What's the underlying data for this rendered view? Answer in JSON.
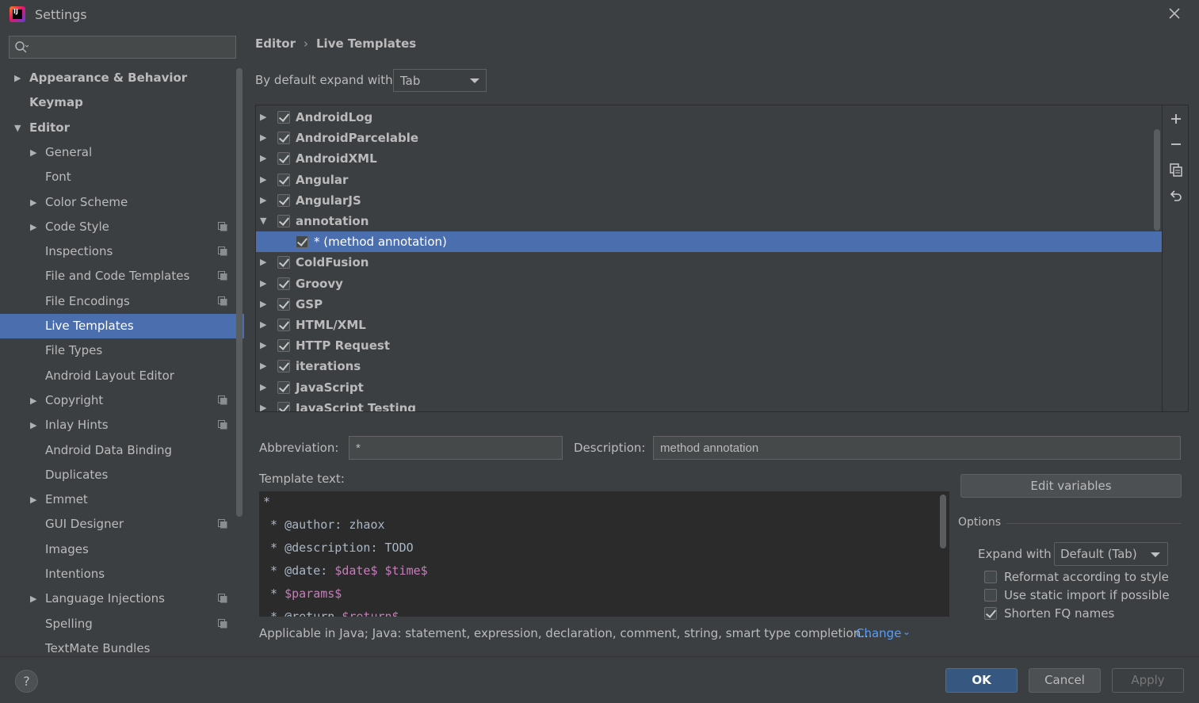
{
  "window": {
    "title": "Settings"
  },
  "sidebar": {
    "search": {
      "placeholder": "",
      "value": ""
    },
    "items": [
      {
        "label": "Appearance & Behavior",
        "bold": true,
        "arrow": "▶",
        "indent": 0
      },
      {
        "label": "Keymap",
        "bold": true,
        "arrow": "",
        "indent": 0
      },
      {
        "label": "Editor",
        "bold": true,
        "arrow": "▼",
        "indent": 0
      },
      {
        "label": "General",
        "arrow": "▶",
        "indent": 1
      },
      {
        "label": "Font",
        "arrow": "",
        "indent": 1
      },
      {
        "label": "Color Scheme",
        "arrow": "▶",
        "indent": 1
      },
      {
        "label": "Code Style",
        "arrow": "▶",
        "indent": 1,
        "project_icon": true
      },
      {
        "label": "Inspections",
        "arrow": "",
        "indent": 1,
        "project_icon": true
      },
      {
        "label": "File and Code Templates",
        "arrow": "",
        "indent": 1,
        "project_icon": true
      },
      {
        "label": "File Encodings",
        "arrow": "",
        "indent": 1,
        "project_icon": true
      },
      {
        "label": "Live Templates",
        "arrow": "",
        "indent": 1,
        "selected": true
      },
      {
        "label": "File Types",
        "arrow": "",
        "indent": 1
      },
      {
        "label": "Android Layout Editor",
        "arrow": "",
        "indent": 1
      },
      {
        "label": "Copyright",
        "arrow": "▶",
        "indent": 1,
        "project_icon": true
      },
      {
        "label": "Inlay Hints",
        "arrow": "▶",
        "indent": 1,
        "project_icon": true
      },
      {
        "label": "Android Data Binding",
        "arrow": "",
        "indent": 1
      },
      {
        "label": "Duplicates",
        "arrow": "",
        "indent": 1
      },
      {
        "label": "Emmet",
        "arrow": "▶",
        "indent": 1
      },
      {
        "label": "GUI Designer",
        "arrow": "",
        "indent": 1,
        "project_icon": true
      },
      {
        "label": "Images",
        "arrow": "",
        "indent": 1
      },
      {
        "label": "Intentions",
        "arrow": "",
        "indent": 1
      },
      {
        "label": "Language Injections",
        "arrow": "▶",
        "indent": 1,
        "project_icon": true
      },
      {
        "label": "Spelling",
        "arrow": "",
        "indent": 1,
        "project_icon": true
      },
      {
        "label": "TextMate Bundles",
        "arrow": "",
        "indent": 1
      }
    ]
  },
  "breadcrumb": {
    "parent": "Editor",
    "separator": "›",
    "current": "Live Templates"
  },
  "expand_default": {
    "label": "By default expand with",
    "value": "Tab"
  },
  "template_groups": [
    {
      "name": "AndroidLog",
      "checked": true,
      "arrow": "▶"
    },
    {
      "name": "AndroidParcelable",
      "checked": true,
      "arrow": "▶"
    },
    {
      "name": "AndroidXML",
      "checked": true,
      "arrow": "▶"
    },
    {
      "name": "Angular",
      "checked": true,
      "arrow": "▶"
    },
    {
      "name": "AngularJS",
      "checked": true,
      "arrow": "▶"
    },
    {
      "name": "annotation",
      "checked": true,
      "arrow": "▼"
    },
    {
      "name": "* (method annotation)",
      "checked": true,
      "arrow": "",
      "child": true,
      "selected": true
    },
    {
      "name": "ColdFusion",
      "checked": true,
      "arrow": "▶"
    },
    {
      "name": "Groovy",
      "checked": true,
      "arrow": "▶"
    },
    {
      "name": "GSP",
      "checked": true,
      "arrow": "▶"
    },
    {
      "name": "HTML/XML",
      "checked": true,
      "arrow": "▶"
    },
    {
      "name": "HTTP Request",
      "checked": true,
      "arrow": "▶"
    },
    {
      "name": "iterations",
      "checked": true,
      "arrow": "▶"
    },
    {
      "name": "JavaScript",
      "checked": true,
      "arrow": "▶"
    },
    {
      "name": "JavaScript Testing",
      "checked": true,
      "arrow": "▶"
    }
  ],
  "list_toolbar": {
    "add": "+",
    "remove": "−"
  },
  "details": {
    "abbreviation_label": "Abbreviation:",
    "abbreviation_value": "*",
    "description_label": "Description:",
    "description_value": "method annotation",
    "template_text_label": "Template text:",
    "template_lines": [
      [
        {
          "t": "*"
        }
      ],
      [
        {
          "t": " * @author: zhaox"
        }
      ],
      [
        {
          "t": " * @description: TODO"
        }
      ],
      [
        {
          "t": " * @date: "
        },
        {
          "t": "$date$",
          "v": true
        },
        {
          "t": " "
        },
        {
          "t": "$time$",
          "v": true
        }
      ],
      [
        {
          "t": " * "
        },
        {
          "t": "$params$",
          "v": true
        }
      ],
      [
        {
          "t": " * @return "
        },
        {
          "t": "$return$",
          "v": true
        }
      ]
    ],
    "applicable_text": "Applicable in Java; Java: statement, expression, declaration, comment, string, smart type completion...",
    "change_link": "Change",
    "change_chevron": "⌄"
  },
  "options": {
    "edit_variables": "Edit variables",
    "title": "Options",
    "expand_with_label": "Expand with",
    "expand_with_value": "Default (Tab)",
    "checks": [
      {
        "label": "Reformat according to style",
        "checked": false
      },
      {
        "label": "Use static import if possible",
        "checked": false
      },
      {
        "label": "Shorten FQ names",
        "checked": true
      }
    ]
  },
  "footer": {
    "help": "?",
    "ok": "OK",
    "cancel": "Cancel",
    "apply": "Apply"
  },
  "colors": {
    "accent": "#4b6eaf",
    "link": "#589df6",
    "background": "#3c3f41",
    "editor_bg": "#2b2b2b",
    "template_var": "#c77dbb",
    "ok_button": "#365880"
  }
}
